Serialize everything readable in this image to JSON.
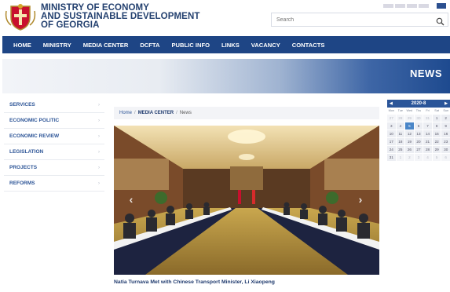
{
  "header": {
    "title_lines": [
      "MINISTRY OF ECONOMY",
      "AND SUSTAINABLE DEVELOPMENT",
      "OF GEORGIA"
    ],
    "search_placeholder": "Search"
  },
  "nav": {
    "items": [
      "HOME",
      "MINISTRY",
      "MEDIA CENTER",
      "DCFTA",
      "PUBLIC INFO",
      "LINKS",
      "VACANCY",
      "CONTACTS"
    ]
  },
  "banner": {
    "title": "NEWS"
  },
  "sidebar": {
    "items": [
      "SERVICES",
      "ECONOMIC POLITIC",
      "ECONOMIC REVIEW",
      "LEGISLATION",
      "PROJECTS",
      "REFORMS"
    ]
  },
  "breadcrumb": [
    "Home",
    "MEDIA CENTER",
    "News"
  ],
  "article": {
    "caption": "Natia Turnava Met with Chinese Transport Minister, Li Xiaopeng"
  },
  "calendar": {
    "month_label": "2020-8",
    "weekdays": [
      "Mon",
      "Tue",
      "Wed",
      "Thu",
      "Fri",
      "Sat",
      "Sun"
    ],
    "weeks": [
      [
        "27",
        "28",
        "29",
        "30",
        "31",
        "1",
        "2"
      ],
      [
        "3",
        "4",
        "5",
        "6",
        "7",
        "8",
        "9"
      ],
      [
        "10",
        "11",
        "12",
        "13",
        "14",
        "15",
        "16"
      ],
      [
        "17",
        "18",
        "19",
        "20",
        "21",
        "22",
        "23"
      ],
      [
        "24",
        "25",
        "26",
        "27",
        "28",
        "29",
        "30"
      ],
      [
        "31",
        "1",
        "2",
        "3",
        "4",
        "5",
        "6"
      ]
    ],
    "highlight_day": "5"
  },
  "colors": {
    "brand_navy": "#1e4585",
    "link_blue": "#2d5597",
    "calendar_header": "#2a5599",
    "calendar_today": "#4a86c8"
  },
  "icons": [
    "coat-of-arms-icon",
    "search-icon",
    "chevron-right-icon",
    "arrow-left-icon",
    "arrow-right-icon"
  ]
}
